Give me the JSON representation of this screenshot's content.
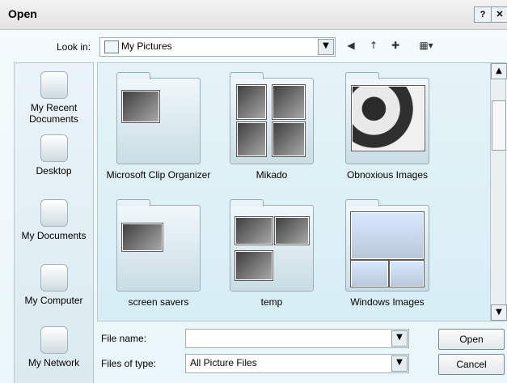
{
  "window": {
    "title": "Open"
  },
  "titlebar": {
    "help_glyph": "?",
    "close_glyph": "✕"
  },
  "lookin": {
    "label": "Look in:",
    "value": "My Pictures",
    "dropdown_glyph": "▼"
  },
  "toolbar": {
    "back_glyph": "◀",
    "up_glyph": "↑",
    "newfolder_glyph": "✚",
    "views_glyph": "▦▾"
  },
  "places": [
    {
      "label": "My Recent\nDocuments",
      "icon": "recent-documents-icon"
    },
    {
      "label": "Desktop",
      "icon": "desktop-icon"
    },
    {
      "label": "My Documents",
      "icon": "documents-icon"
    },
    {
      "label": "My Computer",
      "icon": "computer-icon"
    },
    {
      "label": "My Network",
      "icon": "network-icon"
    }
  ],
  "items": [
    {
      "label": "Microsoft Clip Organizer"
    },
    {
      "label": "Mikado"
    },
    {
      "label": "Obnoxious Images"
    },
    {
      "label": "screen savers"
    },
    {
      "label": "temp"
    },
    {
      "label": "Windows Images"
    }
  ],
  "filename": {
    "label": "File name:",
    "value": ""
  },
  "filetype": {
    "label": "Files of type:",
    "value": "All Picture Files"
  },
  "buttons": {
    "open": "Open",
    "cancel": "Cancel"
  },
  "scroll": {
    "up": "▲",
    "down": "▼"
  }
}
